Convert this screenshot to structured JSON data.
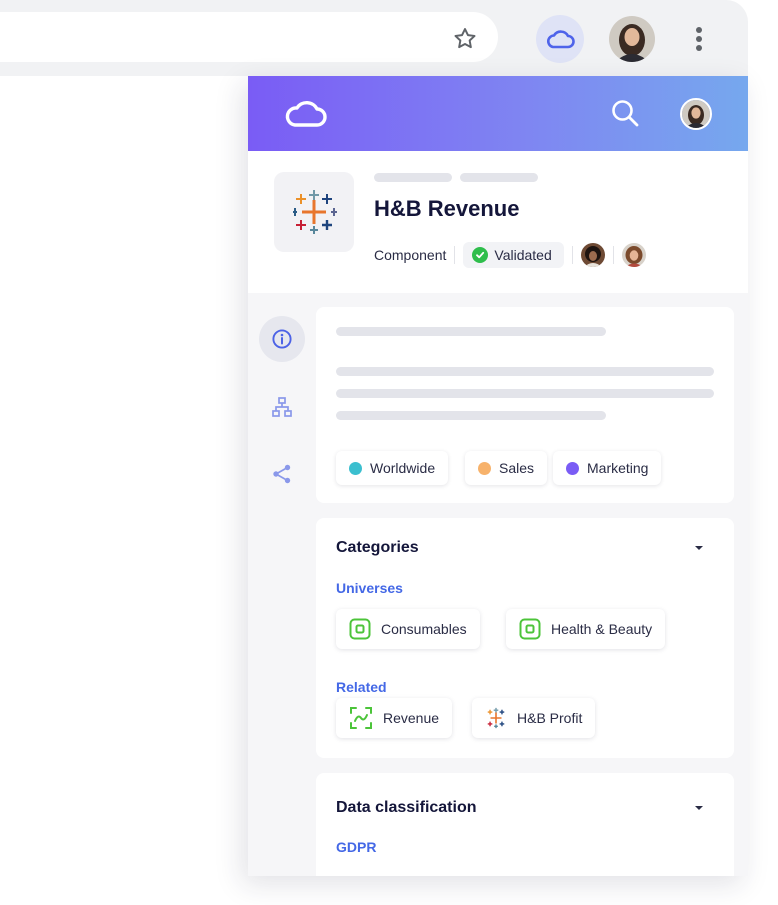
{
  "asset": {
    "title": "H&B Revenue",
    "type": "Component",
    "status": "Validated"
  },
  "tags": [
    {
      "label": "Worldwide",
      "color": "#3bbfcf"
    },
    {
      "label": "Sales",
      "color": "#f7b26b"
    },
    {
      "label": "Marketing",
      "color": "#7a5cf5"
    }
  ],
  "categories": {
    "title": "Categories",
    "universes_label": "Universes",
    "universes": [
      "Consumables",
      "Health & Beauty"
    ],
    "related_label": "Related",
    "related": [
      "Revenue",
      "H&B Profit"
    ]
  },
  "classification": {
    "title": "Data classification",
    "gdpr_label": "GDPR"
  },
  "colors": {
    "header_gradient_start": "#7a5cf5",
    "header_gradient_end": "#76a8ee",
    "accent_blue": "#4468e6",
    "validated_green": "#2fbe4c",
    "universe_green": "#4cc43a"
  },
  "icons": [
    "star-icon",
    "cloud-icon",
    "kebab-menu-icon",
    "search-icon",
    "tableau-icon",
    "info-icon",
    "lineage-icon",
    "share-icon",
    "check-icon",
    "universe-icon",
    "metric-icon",
    "caret-down-icon"
  ]
}
